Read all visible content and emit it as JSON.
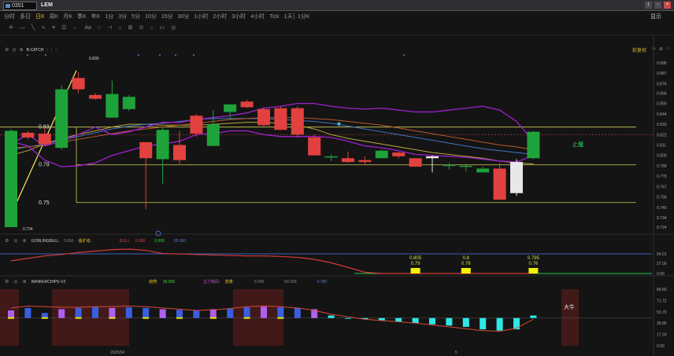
{
  "window": {
    "stock_code": "0351",
    "stock_name": "LEM",
    "controls": [
      "1",
      "−",
      "×"
    ]
  },
  "periods": [
    {
      "label": "分时",
      "active": false
    },
    {
      "label": "多日",
      "active": false
    },
    {
      "label": "日K",
      "active": true
    },
    {
      "label": "周K",
      "active": false
    },
    {
      "label": "月K",
      "active": false
    },
    {
      "label": "季K",
      "active": false
    },
    {
      "label": "年K",
      "active": false
    },
    {
      "label": "1分",
      "active": false
    },
    {
      "label": "3分",
      "active": false
    },
    {
      "label": "5分",
      "active": false
    },
    {
      "label": "10分",
      "active": false
    },
    {
      "label": "15分",
      "active": false
    },
    {
      "label": "30分",
      "active": false
    },
    {
      "label": "1小时",
      "active": false
    },
    {
      "label": "2小时",
      "active": false
    },
    {
      "label": "3小时",
      "active": false
    },
    {
      "label": "4小时",
      "active": false
    },
    {
      "label": "Tick",
      "active": false
    },
    {
      "label": "1天│ 1分K",
      "active": false
    }
  ],
  "display_button": "显示",
  "tools": [
    "✛",
    "—",
    "╲",
    "∿",
    "≡",
    "☰",
    "←",
    "Aa",
    "○",
    "⊣",
    "⌂",
    "⊞",
    "⊙",
    "○",
    "▭",
    "◎"
  ],
  "main_panel": {
    "indicator": "B-CATCH",
    "info_dots": [
      ":",
      ":",
      ":"
    ],
    "restore_label": "前复权",
    "high_label": "0.890",
    "low_label": "0.724",
    "price_lines": [
      {
        "label": "0.83",
        "value": 0.83
      },
      {
        "label": "0.79",
        "value": 0.79
      },
      {
        "label": "0.75",
        "value": 0.75
      }
    ],
    "y_ticks": [
      "0.898",
      "0.887",
      "0.876",
      "0.866",
      "0.855",
      "0.844",
      "0.833",
      "0.822",
      "0.811",
      "0.800",
      "0.789",
      "0.778",
      "0.767",
      "0.756",
      "0.745",
      "0.734",
      "0.724"
    ],
    "annotation": "止魔",
    "candles": [
      {
        "o": 0.724,
        "c": 0.826,
        "h": 0.828,
        "l": 0.724
      },
      {
        "o": 0.824,
        "c": 0.819,
        "h": 0.826,
        "l": 0.817
      },
      {
        "o": 0.823,
        "c": 0.812,
        "h": 0.829,
        "l": 0.811
      },
      {
        "o": 0.808,
        "c": 0.87,
        "h": 0.874,
        "l": 0.806
      },
      {
        "o": 0.882,
        "c": 0.87,
        "h": 0.888,
        "l": 0.866
      },
      {
        "o": 0.864,
        "c": 0.86,
        "h": 0.866,
        "l": 0.859
      },
      {
        "o": 0.84,
        "c": 0.865,
        "h": 0.879,
        "l": 0.84
      },
      {
        "o": 0.849,
        "c": 0.862,
        "h": 0.864,
        "l": 0.847
      },
      {
        "o": 0.814,
        "c": 0.797,
        "h": 0.814,
        "l": 0.743
      },
      {
        "o": 0.796,
        "c": 0.827,
        "h": 0.83,
        "l": 0.77
      },
      {
        "o": 0.811,
        "c": 0.795,
        "h": 0.826,
        "l": 0.791
      },
      {
        "o": 0.842,
        "c": 0.823,
        "h": 0.844,
        "l": 0.82
      },
      {
        "o": 0.81,
        "c": 0.833,
        "h": 0.848,
        "l": 0.81
      },
      {
        "o": 0.846,
        "c": 0.854,
        "h": 0.854,
        "l": 0.838
      },
      {
        "o": 0.857,
        "c": 0.851,
        "h": 0.859,
        "l": 0.85
      },
      {
        "o": 0.849,
        "c": 0.832,
        "h": 0.851,
        "l": 0.83
      },
      {
        "o": 0.85,
        "c": 0.827,
        "h": 0.852,
        "l": 0.827
      },
      {
        "o": 0.85,
        "c": 0.822,
        "h": 0.852,
        "l": 0.819
      },
      {
        "o": 0.819,
        "c": 0.8,
        "h": 0.822,
        "l": 0.8
      },
      {
        "o": 0.799,
        "c": 0.799,
        "h": 0.801,
        "l": 0.794
      },
      {
        "o": 0.797,
        "c": 0.793,
        "h": 0.804,
        "l": 0.792
      },
      {
        "o": 0.795,
        "c": 0.793,
        "h": 0.799,
        "l": 0.79
      },
      {
        "o": 0.797,
        "c": 0.805,
        "h": 0.806,
        "l": 0.797
      },
      {
        "o": 0.803,
        "c": 0.799,
        "h": 0.804,
        "l": 0.797
      },
      {
        "o": 0.797,
        "c": 0.788,
        "h": 0.797,
        "l": 0.788
      },
      {
        "o": 0.797,
        "c": 0.799,
        "h": 0.8,
        "l": 0.782
      },
      {
        "o": 0.79,
        "c": 0.79,
        "h": 0.792,
        "l": 0.785
      },
      {
        "o": 0.789,
        "c": 0.789,
        "h": 0.791,
        "l": 0.783
      },
      {
        "o": 0.782,
        "c": 0.786,
        "h": 0.788,
        "l": 0.782
      },
      {
        "o": 0.786,
        "c": 0.753,
        "h": 0.792,
        "l": 0.753
      },
      {
        "o": 0.76,
        "c": 0.793,
        "h": 0.796,
        "l": 0.757
      },
      {
        "o": 0.797,
        "c": 0.825,
        "h": 0.826,
        "l": 0.796
      }
    ],
    "upper_band": [
      0.812,
      0.822,
      0.81,
      0.815,
      0.822,
      0.83,
      0.822,
      0.825,
      0.83,
      0.835,
      0.835,
      0.838,
      0.84,
      0.842,
      0.845,
      0.85,
      0.852,
      0.855,
      0.855,
      0.852,
      0.85,
      0.849,
      0.85,
      0.848,
      0.846,
      0.846,
      0.848,
      0.85,
      0.852,
      0.848,
      0.836,
      0.815
    ],
    "lower_band": [
      0.815,
      0.81,
      0.795,
      0.788,
      0.789,
      0.792,
      0.8,
      0.805,
      0.81,
      0.812,
      0.815,
      0.822,
      0.823,
      0.826,
      0.826,
      0.822,
      0.82,
      0.82,
      0.82,
      0.819,
      0.815,
      0.81,
      0.808,
      0.805,
      0.801,
      0.8,
      0.799,
      0.798,
      0.796,
      0.794,
      0.793,
      0.8
    ],
    "ma_yellow": [
      0.8,
      0.805,
      0.812,
      0.818,
      0.822,
      0.826,
      0.83,
      0.833,
      0.833,
      0.832,
      0.832,
      0.832,
      0.833,
      0.834,
      0.835,
      0.835,
      0.834,
      0.832,
      0.828,
      0.822,
      0.818,
      0.815,
      0.812,
      0.809,
      0.806,
      0.803,
      0.801,
      0.799,
      0.797,
      0.794,
      0.792,
      0.791
    ],
    "ma_blue": [
      0.806,
      0.809,
      0.812,
      0.816,
      0.82,
      0.824,
      0.828,
      0.831,
      0.833,
      0.834,
      0.836,
      0.838,
      0.839,
      0.839,
      0.839,
      0.839,
      0.838,
      0.837,
      0.836,
      0.834,
      0.831,
      0.828,
      0.825,
      0.822,
      0.819,
      0.816,
      0.813,
      0.81,
      0.807,
      0.805,
      0.803,
      0.801
    ],
    "ma_orange": [
      0.808,
      0.809,
      0.811,
      0.814,
      0.817,
      0.82,
      0.823,
      0.826,
      0.828,
      0.83,
      0.832,
      0.834,
      0.836,
      0.838,
      0.839,
      0.84,
      0.84,
      0.84,
      0.839,
      0.838,
      0.836,
      0.834,
      0.832,
      0.829,
      0.826,
      0.823,
      0.82,
      0.817,
      0.814,
      0.811,
      0.809,
      0.806
    ]
  },
  "sub1": {
    "indicator": "GOBLINGBULL",
    "field1": "0.000",
    "label2": "金矿线:",
    "label3": "BULL:",
    "field3": "0.000",
    "field4": "0.000",
    "field5": "55.000",
    "y_ticks": [
      "54.01",
      "27.00",
      "0.00"
    ],
    "red_line": [
      0.52,
      0.62,
      0.72,
      0.78,
      0.86,
      0.92,
      0.98,
      1.0,
      0.95,
      0.82,
      0.8,
      0.78,
      0.76,
      0.74,
      0.72,
      0.72,
      0.7,
      0.66,
      0.58,
      0.44,
      0.25,
      0.05,
      0,
      0,
      0,
      0,
      0,
      0,
      0,
      0,
      0,
      0
    ],
    "bars": [
      {
        "index": 24,
        "top": "0.805",
        "bottom": "0.79"
      },
      {
        "index": 27,
        "top": "0.8",
        "bottom": "0.78"
      },
      {
        "index": 31,
        "top": "0.795",
        "bottom": "0.76"
      }
    ]
  },
  "sub2": {
    "indicator": "BANKERCHIPS-V2",
    "label_trend": "趋势:",
    "value_trend": "39.098",
    "label_main": "主力筹码:",
    "label_flow": "流通:",
    "value_a": "0.000",
    "value_b": "50.000",
    "value_c": "0.789",
    "y_ticks": [
      "89.66",
      "71.72",
      "53.79",
      "35.86",
      "17.93",
      "0.00"
    ],
    "annotation": "大牛",
    "bars": [
      56,
      60,
      52,
      58,
      60,
      62,
      60,
      61,
      60,
      58,
      57,
      56,
      58,
      59,
      61,
      62,
      61,
      60,
      58,
      48,
      44,
      42,
      40,
      38,
      36,
      34,
      32,
      30,
      26,
      24,
      26,
      48
    ],
    "line": [
      60,
      63,
      62,
      61,
      61,
      62,
      62,
      63,
      62,
      60,
      58,
      56,
      57,
      59,
      62,
      63,
      62,
      60,
      56,
      50,
      46,
      42,
      40,
      38,
      36,
      33,
      30,
      27,
      24,
      23,
      28,
      42
    ]
  },
  "dates": [
    "2025/04",
    "5"
  ]
}
